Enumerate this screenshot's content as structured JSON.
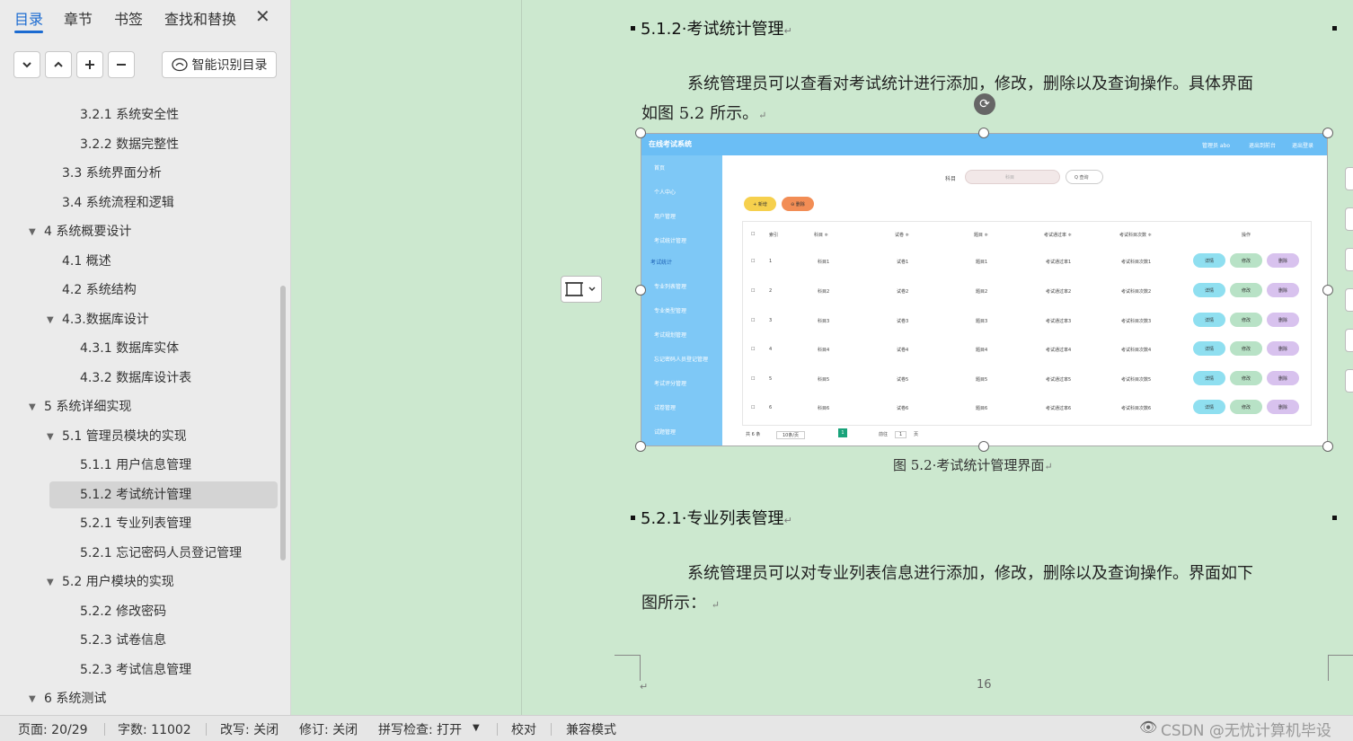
{
  "sidebar": {
    "tabs": [
      "目录",
      "章节",
      "书签",
      "查找和替换"
    ],
    "smart_button": "智能识别目录",
    "toc": [
      {
        "label": "3.2.1  系统安全性",
        "level": 3
      },
      {
        "label": "3.2.2  数据完整性",
        "level": 3
      },
      {
        "label": "3.3 系统界面分析",
        "level": 2
      },
      {
        "label": "3.4 系统流程和逻辑",
        "level": 2
      },
      {
        "label": "4 系统概要设计",
        "level": 1,
        "expanded": true
      },
      {
        "label": "4.1 概述",
        "level": 2
      },
      {
        "label": "4.2 系统结构",
        "level": 2
      },
      {
        "label": "4.3.数据库设计",
        "level": 2,
        "expanded": true
      },
      {
        "label": "4.3.1 数据库实体",
        "level": 3
      },
      {
        "label": "4.3.2 数据库设计表",
        "level": 3
      },
      {
        "label": "5 系统详细实现",
        "level": 1,
        "expanded": true
      },
      {
        "label": "5.1  管理员模块的实现",
        "level": 2,
        "expanded": true
      },
      {
        "label": "5.1.1  用户信息管理",
        "level": 3
      },
      {
        "label": "5.1.2  考试统计管理",
        "level": 3,
        "active": true
      },
      {
        "label": "5.2.1  专业列表管理",
        "level": 3
      },
      {
        "label": "5.2.1  忘记密码人员登记管理",
        "level": 3
      },
      {
        "label": "5.2  用户模块的实现",
        "level": 2,
        "expanded": true
      },
      {
        "label": "5.2.2  修改密码",
        "level": 3
      },
      {
        "label": "5.2.3  试卷信息",
        "level": 3
      },
      {
        "label": "5.2.3  考试信息管理",
        "level": 3
      },
      {
        "label": "6 系统测试",
        "level": 1,
        "expanded": true
      }
    ]
  },
  "document": {
    "heading1": "5.1.2·考试统计管理",
    "para1_line1": "系统管理员可以查看对考试统计进行添加，修改，删除以及查询操作。具体界面",
    "para1_line2": "如图 5.2 所示。",
    "caption": "图 5.2·考试统计管理界面",
    "heading2": "5.2.1·专业列表管理",
    "para2_line1": "系统管理员可以对专业列表信息进行添加，修改，删除以及查询操作。界面如下",
    "para2_line2": "图所示：",
    "page_number": "16",
    "return_mark": "↵"
  },
  "embedded": {
    "app_title": "在线考试系统",
    "top_links": [
      "管理员 abo",
      "退出到前台",
      "退出登录"
    ],
    "menu": [
      "首页",
      "个人中心",
      "用户管理",
      "考试统计管理",
      "考试统计",
      "专业列表管理",
      "专业类型管理",
      "考试规划管理",
      "忘记密码人员登记管理",
      "考试评分管理",
      "试卷管理",
      "试题管理"
    ],
    "search_label": "科目",
    "search_placeholder": "科目",
    "query_btn": "Q 查询",
    "add_btn": "+ 新增",
    "del_btn": "⊖ 删除",
    "headers": [
      "索引",
      "科目 ≑",
      "试卷 ≑",
      "题目 ≑",
      "考试通过率 ≑",
      "考试科目次数 ≑",
      "操作"
    ],
    "rows": [
      [
        "1",
        "科目1",
        "试卷1",
        "题目1",
        "考试通过率1",
        "考试科目次数1"
      ],
      [
        "2",
        "科目2",
        "试卷2",
        "题目2",
        "考试通过率2",
        "考试科目次数2"
      ],
      [
        "3",
        "科目3",
        "试卷3",
        "题目3",
        "考试通过率3",
        "考试科目次数3"
      ],
      [
        "4",
        "科目4",
        "试卷4",
        "题目4",
        "考试通过率4",
        "考试科目次数4"
      ],
      [
        "5",
        "科目5",
        "试卷5",
        "题目5",
        "考试通过率5",
        "考试科目次数5"
      ],
      [
        "6",
        "科目6",
        "试卷6",
        "题目6",
        "考试通过率6",
        "考试科目次数6"
      ]
    ],
    "actions": [
      "详情",
      "修改",
      "删除"
    ],
    "pagination": {
      "total": "共 6 条",
      "page_size": "10条/页",
      "current": "1",
      "goto": "前往",
      "goto_page": "1",
      "unit": "页"
    }
  },
  "status": {
    "page": "页面: 20/29",
    "words": "字数: 11002",
    "overwrite": "改写: 关闭",
    "revision": "修订: 关闭",
    "spell": "拼写检查: 打开",
    "proof": "校对",
    "compat": "兼容模式",
    "watermark": "CSDN @无忧计算机毕设"
  },
  "colors": {
    "accent": "#1b6bd1",
    "doc_bg": "#cce8cf",
    "embed_top": "#6bbef5"
  }
}
